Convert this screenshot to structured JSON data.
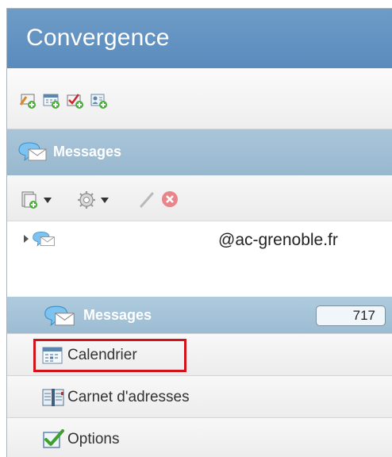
{
  "app": {
    "title": "Convergence"
  },
  "quick_toolbar": {
    "icons": [
      "new-message-icon",
      "new-event-icon",
      "new-task-icon",
      "new-contact-icon"
    ]
  },
  "mail_header": {
    "label": "Messages",
    "icon": "messages-icon"
  },
  "folder_toolbar": {
    "icons": [
      "new-folder-icon",
      "settings-gear-icon",
      "rename-pencil-icon",
      "delete-icon"
    ]
  },
  "folder_tree": {
    "account": "@ac-grenoble.fr"
  },
  "nav": {
    "items": [
      {
        "label": "Messages",
        "icon": "messages-icon",
        "badge": "717",
        "active": true
      },
      {
        "label": "Calendrier",
        "icon": "calendar-icon",
        "highlighted": true
      },
      {
        "label": "Carnet d'adresses",
        "icon": "address-book-icon"
      },
      {
        "label": "Options",
        "icon": "options-checkbox-icon"
      }
    ]
  },
  "colors": {
    "title_bar": "#5a8bbd",
    "section_header": "#9cbcd3",
    "highlight": "#d1141c"
  }
}
